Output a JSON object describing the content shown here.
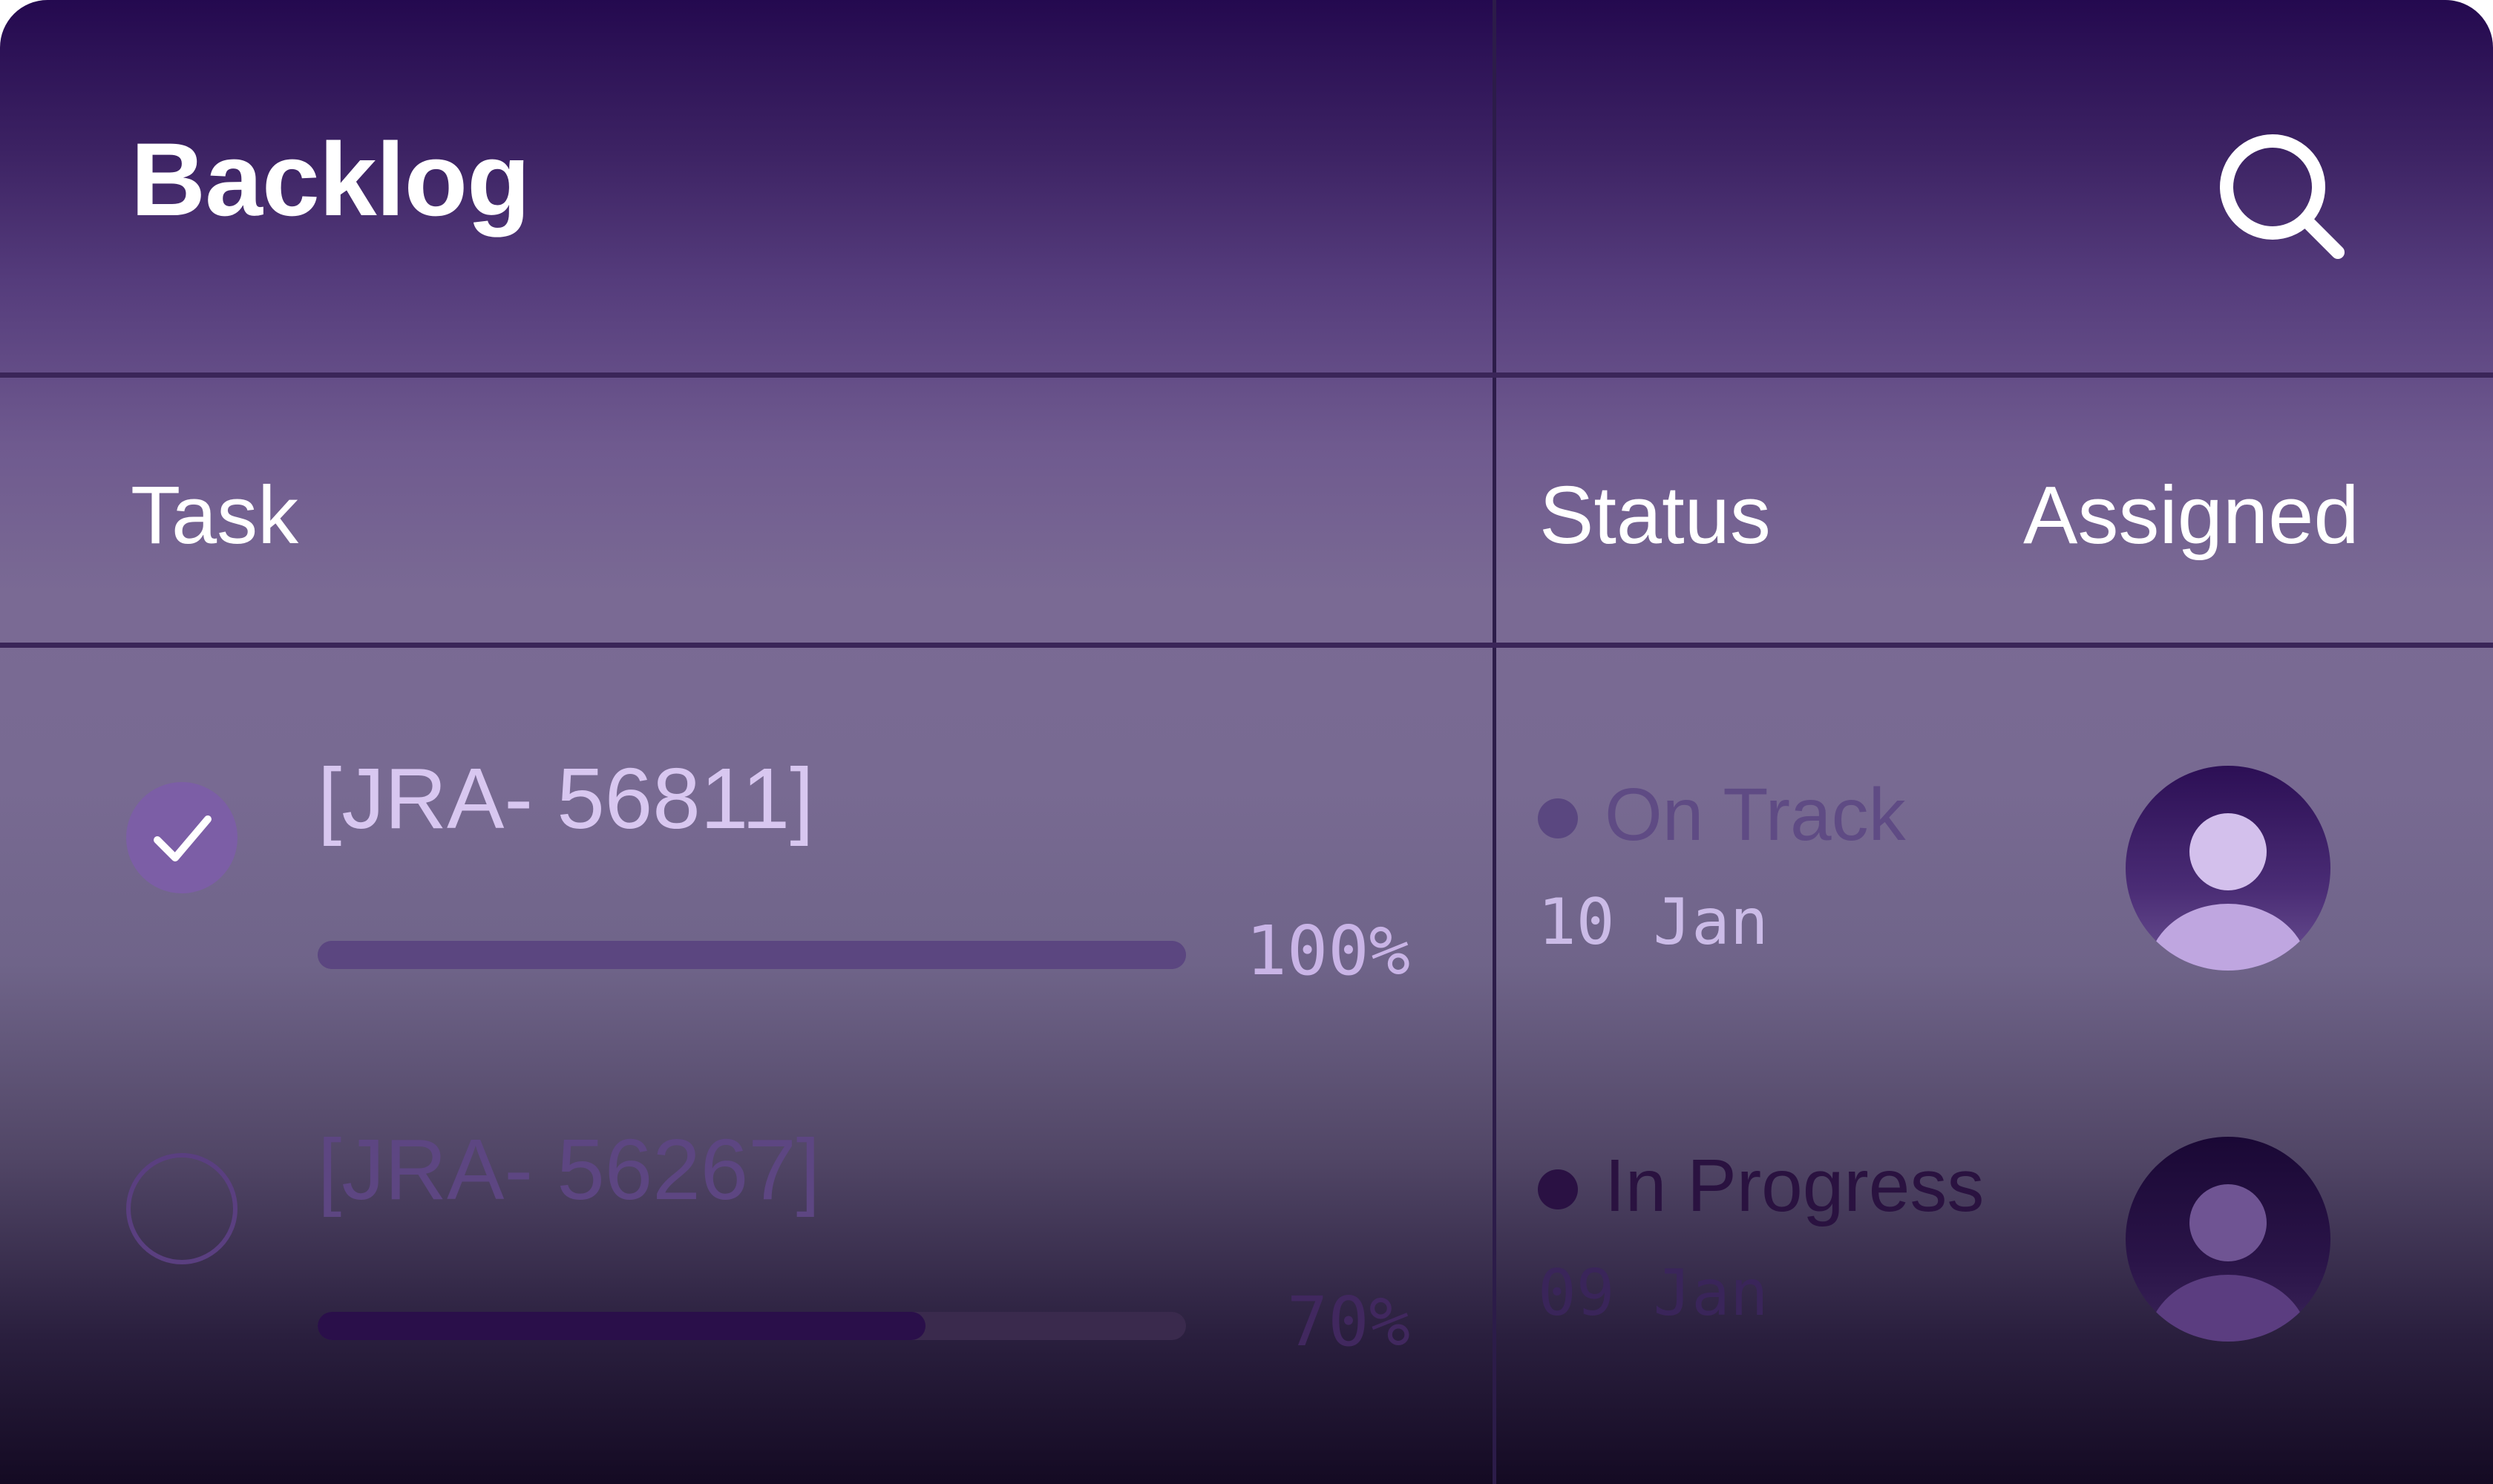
{
  "header": {
    "title": "Backlog",
    "search_icon": "search-icon"
  },
  "columns": {
    "task": "Task",
    "status": "Status",
    "assigned": "Assigned"
  },
  "colors": {
    "background_top": "#24094f",
    "background_mid": "#7a6a94",
    "background_bottom": "#140a23",
    "accent": "#7c5ea6",
    "divider": "#3a2558"
  },
  "rows": [
    {
      "task_id": "[JRA- 56811]",
      "done": true,
      "progress": 1.0,
      "percent_label": "100%",
      "status": "On Track",
      "status_color": "#5a4780",
      "status_text_color": "#5f4b84",
      "date": "10 Jan",
      "date_color": "#cbbbe7",
      "avatar_icon": "user-avatar-icon"
    },
    {
      "task_id": "[JRA- 56267]",
      "done": false,
      "progress": 0.7,
      "percent_label": "70%",
      "status": "In Progress",
      "status_color": "#2a1143",
      "status_text_color": "#2a1240",
      "date": "09 Jan",
      "date_color": "#3a255a",
      "avatar_icon": "user-avatar-icon"
    }
  ]
}
